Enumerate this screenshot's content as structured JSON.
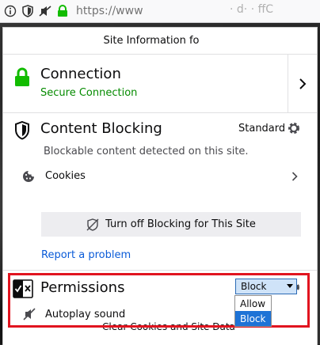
{
  "urlbar": {
    "url": "https://www",
    "url_tail": "· d· · ffC"
  },
  "panel": {
    "header_title": "Site Information fo",
    "connection": {
      "title": "Connection",
      "status": "Secure Connection"
    },
    "content_blocking": {
      "title": "Content Blocking",
      "mode": "Standard",
      "description": "Blockable content detected on this site.",
      "cookies_label": "Cookies",
      "turn_off_label": "Turn off Blocking for This Site",
      "report_link": "Report a problem"
    },
    "permissions": {
      "title": "Permissions",
      "autoplay_label": "Autoplay sound",
      "autoplay_value": "Block",
      "options": [
        "Allow",
        "Block"
      ],
      "clear_label": "Clear Cookies and Site Data"
    }
  },
  "colors": {
    "secure_green": "#058b00",
    "link_blue": "#0a5bd8",
    "highlight_red": "#e1141f",
    "selected_option": "#1e73d6"
  }
}
